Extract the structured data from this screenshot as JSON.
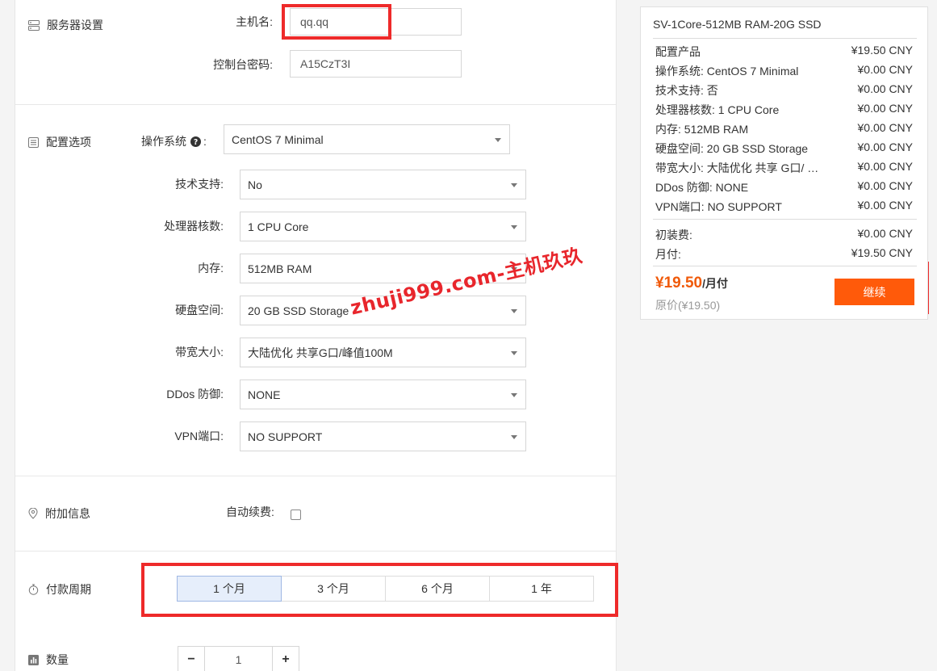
{
  "server": {
    "section_title": "服务器设置",
    "hostname_label": "主机名:",
    "hostname_value": "qq.qq",
    "password_label": "控制台密码:",
    "password_value": "A15CzT3I"
  },
  "config": {
    "section_title": "配置选项",
    "os_label": "操作系统",
    "os_colon": ":",
    "os_value": "CentOS 7 Minimal",
    "fields": [
      {
        "label": "技术支持:",
        "value": "No"
      },
      {
        "label": "处理器核数:",
        "value": "1 CPU Core"
      },
      {
        "label": "内存:",
        "value": "512MB RAM"
      },
      {
        "label": "硬盘空间:",
        "value": "20 GB SSD Storage"
      },
      {
        "label": "带宽大小:",
        "value": "大陆优化 共享G口/峰值100M"
      },
      {
        "label": "DDos 防御:",
        "value": "NONE"
      },
      {
        "label": "VPN端口:",
        "value": "NO SUPPORT"
      }
    ]
  },
  "additional": {
    "section_title": "附加信息",
    "auto_renew_label": "自动续费:",
    "auto_renew_checked": false
  },
  "billing": {
    "section_title": "付款周期",
    "options": [
      "1 个月",
      "3 个月",
      "6 个月",
      "1 年"
    ],
    "selected": "1 个月"
  },
  "quantity": {
    "section_title": "数量",
    "minus": "−",
    "plus": "+",
    "value": "1"
  },
  "watermark": "zhuji999.com-主机玖玖",
  "summary": {
    "product": "SV-1Core-512MB RAM-20G SSD",
    "lines": [
      {
        "name": "配置产品",
        "price": "¥19.50 CNY"
      },
      {
        "name": "操作系统: CentOS 7 Minimal",
        "price": "¥0.00 CNY"
      },
      {
        "name": "技术支持: 否",
        "price": "¥0.00 CNY"
      },
      {
        "name": "处理器核数: 1 CPU Core",
        "price": "¥0.00 CNY"
      },
      {
        "name": "内存: 512MB RAM",
        "price": "¥0.00 CNY"
      },
      {
        "name": "硬盘空间: 20 GB SSD Storage",
        "price": "¥0.00 CNY"
      },
      {
        "name": "带宽大小: 大陆优化 共享 G口/ …",
        "price": "¥0.00 CNY"
      },
      {
        "name": "DDos 防御: NONE",
        "price": "¥0.00 CNY"
      },
      {
        "name": "VPN端口: NO SUPPORT",
        "price": "¥0.00 CNY"
      }
    ],
    "setup_label": "初装费:",
    "setup_price": "¥0.00 CNY",
    "monthly_label": "月付:",
    "monthly_price": "¥19.50 CNY",
    "total_amount": "¥19.50",
    "total_period": "/月付",
    "original_price": "原价(¥19.50)",
    "continue_label": "继续"
  },
  "colors": {
    "accent": "#ff5a0a",
    "highlight": "#ee2a2a",
    "selected_bg": "#e6eefb"
  }
}
